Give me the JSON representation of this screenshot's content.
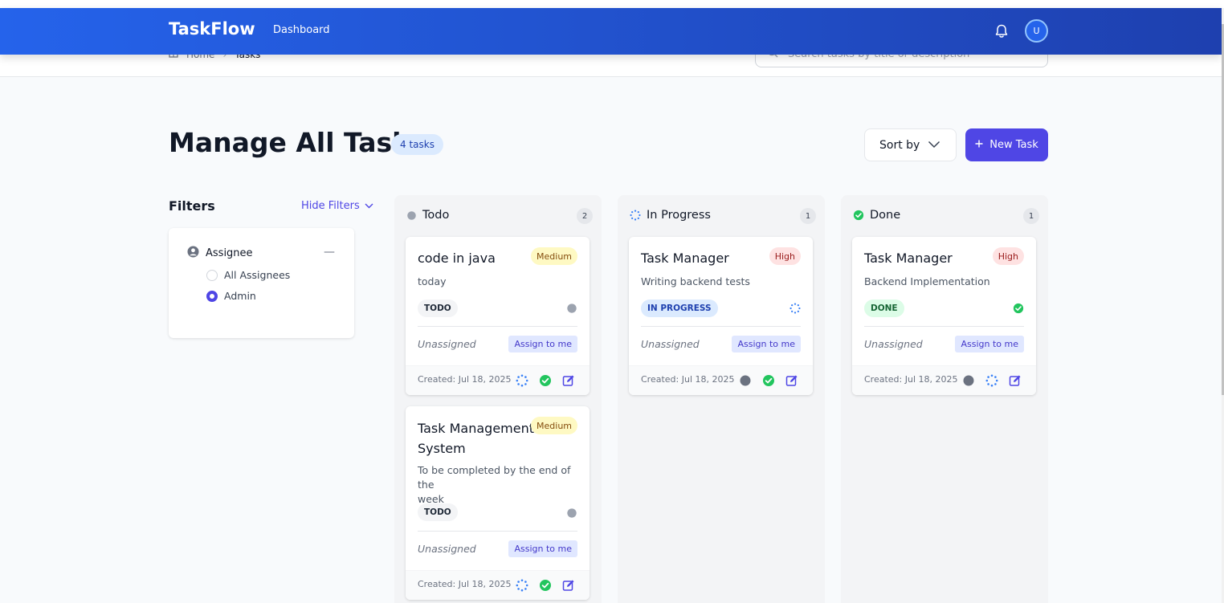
{
  "nav": {
    "brand": "TaskFlow",
    "link_dashboard": "Dashboard",
    "avatar_initial": "U"
  },
  "breadcrumb": {
    "home": "Home",
    "separator": "›",
    "current": "Tasks"
  },
  "search": {
    "placeholder": "Search tasks by title or description"
  },
  "header": {
    "title": "Manage All Tasks",
    "count_badge": "4 tasks",
    "sort_label": "Sort by",
    "new_task_label": "New Task"
  },
  "filters": {
    "title": "Filters",
    "toggle_label": "Hide Filters",
    "group_label": "Assignee",
    "options": [
      {
        "label": "All Assignees",
        "selected": false
      },
      {
        "label": "Admin",
        "selected": true
      }
    ]
  },
  "colors": {
    "accent": "#4f46e5",
    "nav_start": "#2563eb",
    "nav_end": "#1e40af",
    "done_green": "#22c55e",
    "progress_blue": "#3b82f6",
    "todo_gray": "#9ca3af"
  },
  "columns": [
    {
      "title": "Todo",
      "count": "2",
      "icon": "todo-dot-icon",
      "cards": [
        {
          "title": "code in java",
          "priority": "Medium",
          "description": "today",
          "status": "TODO",
          "assignee": "Unassigned",
          "assign_label": "Assign to me",
          "created": "Created: Jul 18, 2025"
        },
        {
          "title_line1": "Task Management",
          "title_line2": "System",
          "priority": "Medium",
          "description_line1": "To be completed by the end of the",
          "description_line2": "week",
          "status": "TODO",
          "assignee": "Unassigned",
          "assign_label": "Assign to me",
          "created": "Created: Jul 18, 2025"
        }
      ]
    },
    {
      "title": "In Progress",
      "count": "1",
      "icon": "in-progress-spinner-icon",
      "cards": [
        {
          "title": "Task Manager",
          "priority": "High",
          "description": "Writing backend tests",
          "status": "IN PROGRESS",
          "assignee": "Unassigned",
          "assign_label": "Assign to me",
          "created": "Created: Jul 18, 2025"
        }
      ]
    },
    {
      "title": "Done",
      "count": "1",
      "icon": "done-check-icon",
      "cards": [
        {
          "title": "Task Manager",
          "priority": "High",
          "description": "Backend Implementation",
          "status": "DONE",
          "assignee": "Unassigned",
          "assign_label": "Assign to me",
          "created": "Created: Jul 18, 2025"
        }
      ]
    }
  ]
}
